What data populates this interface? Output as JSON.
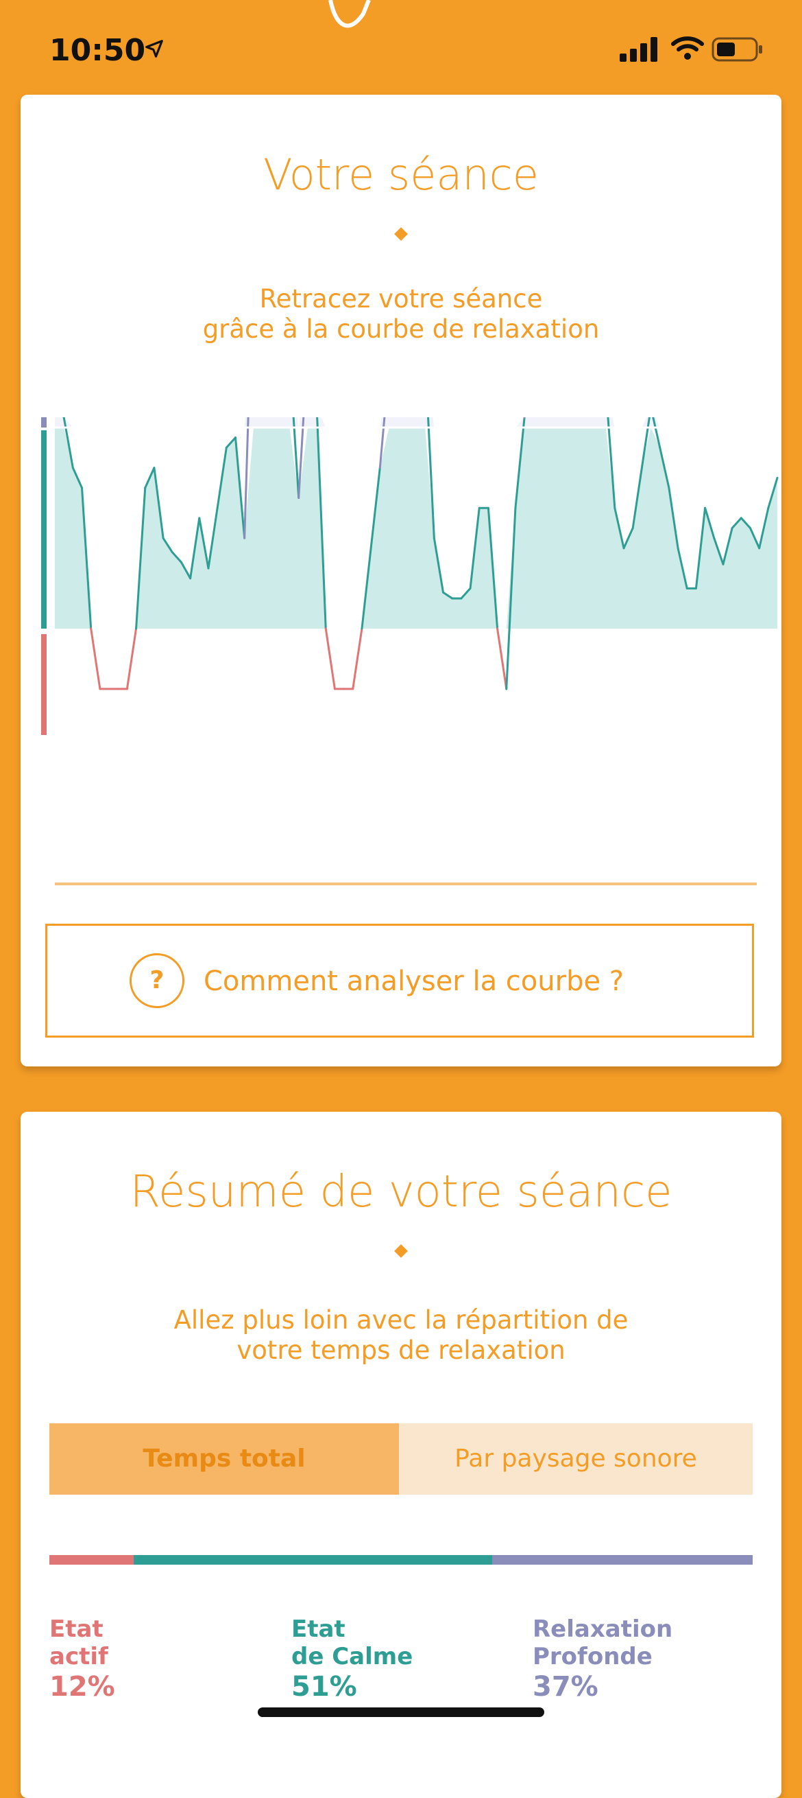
{
  "status": {
    "time": "10:50",
    "icons": [
      "location-arrow-icon",
      "signal-icon",
      "wifi-icon",
      "battery-icon"
    ]
  },
  "session_card": {
    "title": "Votre séance",
    "subtitle_line1": "Retracez votre séance",
    "subtitle_line2": "grâce à la courbe de relaxation",
    "help_label": "Comment analyser la courbe ?",
    "help_icon": "?"
  },
  "chart_data": {
    "type": "area",
    "zones": {
      "deep_relaxation": [
        1,
        1.7
      ],
      "calm": [
        0,
        1
      ],
      "active": [
        -0.4,
        0
      ]
    },
    "colors": {
      "active": "#E07575",
      "calm": "#2E9E94",
      "calm_fill": "#CDEBE8",
      "deep": "#8A8DBA",
      "deep_fill": "#F2F2FA"
    },
    "values": [
      1.35,
      1.05,
      0.8,
      0.7,
      0,
      -0.3,
      -0.3,
      -0.3,
      -0.3,
      0,
      0.7,
      0.8,
      0.45,
      0.38,
      0.33,
      0.25,
      0.55,
      0.3,
      0.6,
      0.9,
      0.95,
      0.45,
      1.9,
      2.1,
      2.05,
      1.9,
      1.35,
      0.65,
      1.4,
      1.1,
      0,
      -0.3,
      -0.3,
      -0.3,
      0,
      0.4,
      0.8,
      1.3,
      2.1,
      2.12,
      1.8,
      1.35,
      0.45,
      0.18,
      0.15,
      0.15,
      0.2,
      0.6,
      0.6,
      0,
      -0.3,
      0.6,
      1.05,
      2.1,
      2.1,
      1.2,
      1.1,
      1.3,
      1.5,
      2.1,
      2.05,
      1.2,
      0.6,
      0.4,
      0.5,
      0.8,
      1.1,
      0.9,
      0.7,
      0.4,
      0.2,
      0.2,
      0.6,
      0.45,
      0.32,
      0.5,
      0.55,
      0.5,
      0.4,
      0.6,
      0.75
    ]
  },
  "summary_card": {
    "title": "Résumé de votre séance",
    "subtitle_line1": "Allez plus loin avec la répartition de",
    "subtitle_line2": "votre temps de relaxation",
    "tabs": [
      "Temps total",
      "Par paysage sonore"
    ],
    "distribution": [
      {
        "label_line1": "Etat",
        "label_line2": "actif",
        "pct": "12%",
        "value": 12,
        "color": "#E07575"
      },
      {
        "label_line1": "Etat",
        "label_line2": "de Calme",
        "pct": "51%",
        "value": 51,
        "color": "#2E9E94"
      },
      {
        "label_line1": "Relaxation",
        "label_line2": "Profonde",
        "pct": "37%",
        "value": 37,
        "color": "#8A8DBA"
      }
    ]
  }
}
